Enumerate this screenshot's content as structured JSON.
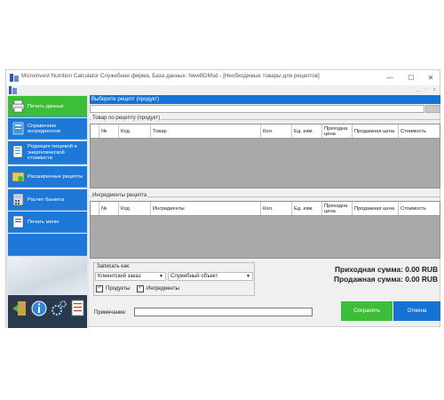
{
  "window": {
    "title": "Microinvest Nutrition Calculator Служебная фирма, База данных: NewBDMsd - [Необходимые товары для рецептов]",
    "min_glyph": "—",
    "max_glyph": "☐",
    "close_glyph": "✕"
  },
  "mdi": {
    "min": "_",
    "restore": "▫",
    "close": "x"
  },
  "sidebar": {
    "items": [
      {
        "label": "Печать данных",
        "icon": "printer-icon"
      },
      {
        "label": "Справочник ингредиентов",
        "icon": "book-icon"
      },
      {
        "label": "Редакция пищевой и энергетической стоимости",
        "icon": "document-edit-icon"
      },
      {
        "label": "Расширенные рецепты",
        "icon": "recipe-folder-icon"
      },
      {
        "label": "Расчет банкета",
        "icon": "calculator-icon"
      },
      {
        "label": "Печать меню",
        "icon": "menu-document-icon"
      }
    ],
    "bottom_icons": [
      "exit-icon",
      "info-icon",
      "settings-icon",
      "report-icon"
    ]
  },
  "recipe": {
    "select_label": "Выберите рецепт (продукт)",
    "value": ""
  },
  "products_grid": {
    "title": "Товар по рецепту (продукт)",
    "columns": [
      "№",
      "Код",
      "Товар",
      "Кол.",
      "Ед. изм.",
      "Приходна цена",
      "Продажная цена",
      "Стоимость"
    ]
  },
  "ingredients_grid": {
    "title": "Ингредиенты рецепта",
    "columns": [
      "№",
      "Код",
      "Ингредиенты",
      "Кол.",
      "Ед. изм.",
      "Приходна цена",
      "Продажная цена",
      "Стоимость"
    ]
  },
  "save_as": {
    "label": "Записать как:",
    "type_value": "Клиентский заказ",
    "object_value": "Служебный объект",
    "products_label": "Продукты",
    "ingredients_label": "Ингредиенты",
    "products_checked": true,
    "ingredients_checked": true
  },
  "totals": {
    "purchase": "Приходная сумма: 0.00 RUB",
    "sale": "Продажная сумма: 0.00 RUB"
  },
  "note": {
    "label": "Примечание:",
    "value": ""
  },
  "buttons": {
    "save": "Сохранить",
    "cancel": "Отмена"
  },
  "colors": {
    "accent_blue": "#1573d3",
    "accent_green": "#3cbe38",
    "grid_bg": "#a9a9a9"
  }
}
